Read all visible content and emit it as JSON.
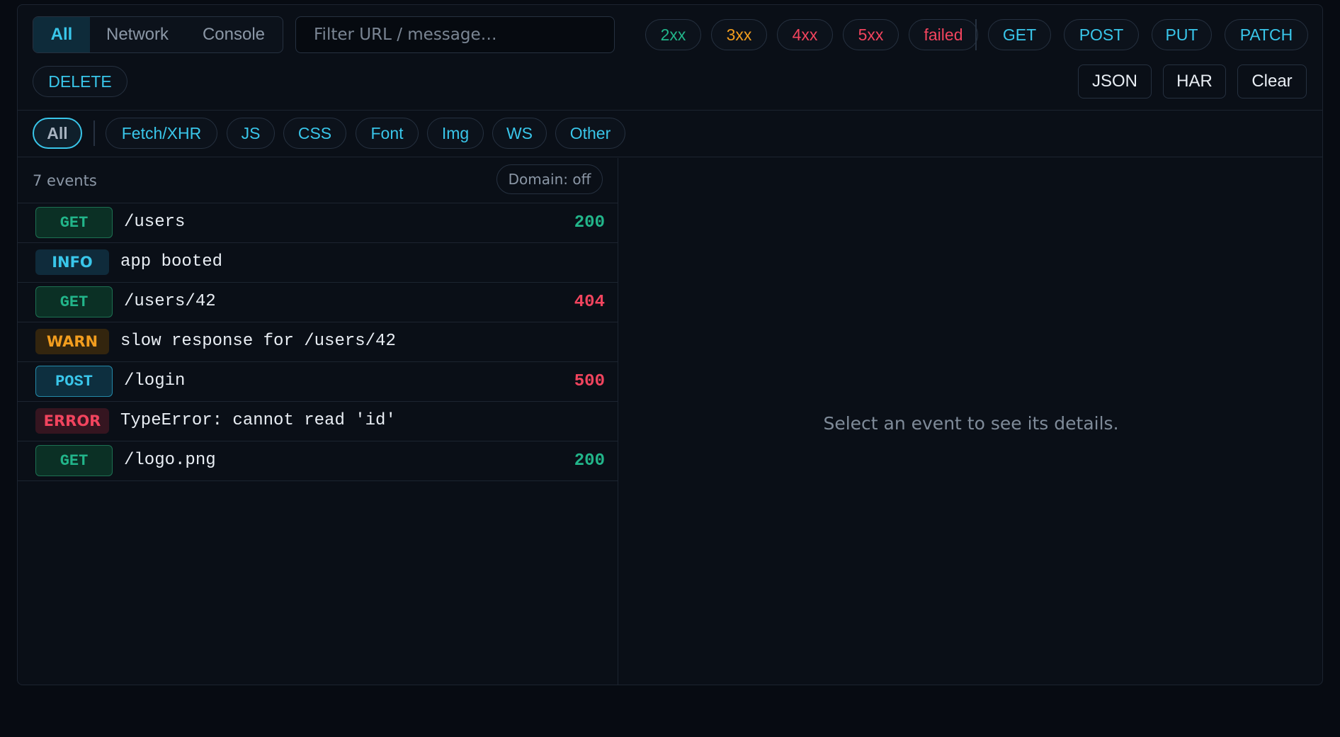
{
  "view_tabs": [
    "All",
    "Network",
    "Console"
  ],
  "search": {
    "placeholder": "Filter URL / message…"
  },
  "status_filters": [
    "2xx",
    "3xx",
    "4xx",
    "5xx",
    "failed"
  ],
  "method_filters": [
    "GET",
    "POST",
    "PUT",
    "PATCH",
    "DELETE"
  ],
  "actions": {
    "json": "JSON",
    "har": "HAR",
    "clear": "Clear"
  },
  "type_filters": [
    "All",
    "Fetch/XHR",
    "JS",
    "CSS",
    "Font",
    "Img",
    "WS",
    "Other"
  ],
  "list": {
    "count_label": "7 events",
    "domain_toggle": "Domain: off",
    "events": [
      {
        "badge": "GET",
        "text": "/users",
        "status": "200"
      },
      {
        "badge": "INFO",
        "text": "app booted"
      },
      {
        "badge": "GET",
        "text": "/users/42",
        "status": "404"
      },
      {
        "badge": "WARN",
        "text": "slow response for /users/42"
      },
      {
        "badge": "POST",
        "text": "/login",
        "status": "500"
      },
      {
        "badge": "ERROR",
        "text": "TypeError: cannot read 'id'"
      },
      {
        "badge": "GET",
        "text": "/logo.png",
        "status": "200"
      }
    ]
  },
  "details": {
    "empty_message": "Select an event to see its details."
  },
  "colors": {
    "accent": "#39c6ea",
    "success": "#22b58a",
    "warning": "#f29d1e",
    "error": "#f2445e"
  }
}
